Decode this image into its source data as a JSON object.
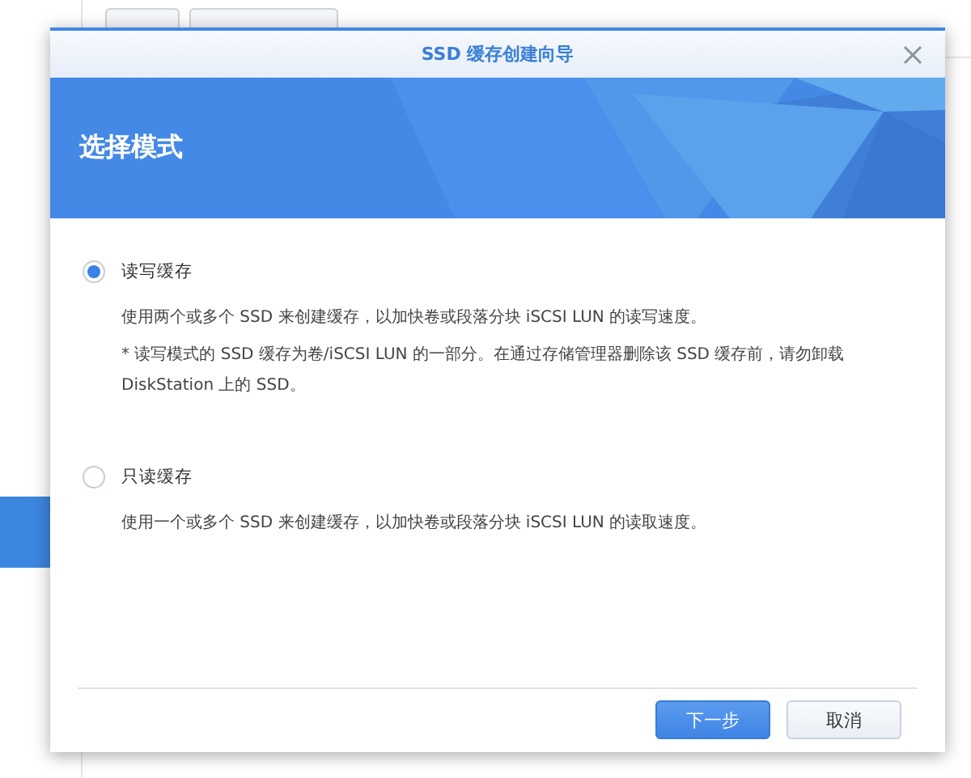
{
  "dialog": {
    "title": "SSD 缓存创建向导",
    "heading": "选择模式",
    "options": [
      {
        "label": "读写缓存",
        "selected": true,
        "description": "使用两个或多个 SSD 来创建缓存，以加快卷或段落分块 iSCSI LUN 的读写速度。",
        "note": "* 读写模式的 SSD 缓存为卷/iSCSI LUN 的一部分。在通过存储管理器删除该 SSD 缓存前，请勿卸载 DiskStation 上的 SSD。"
      },
      {
        "label": "只读缓存",
        "selected": false,
        "description": "使用一个或多个 SSD 来创建缓存，以加快卷或段落分块 iSCSI LUN 的读取速度。"
      }
    ],
    "buttons": [
      {
        "label": "下一步",
        "kind": "primary"
      },
      {
        "label": "取消",
        "kind": "secondary"
      }
    ]
  }
}
